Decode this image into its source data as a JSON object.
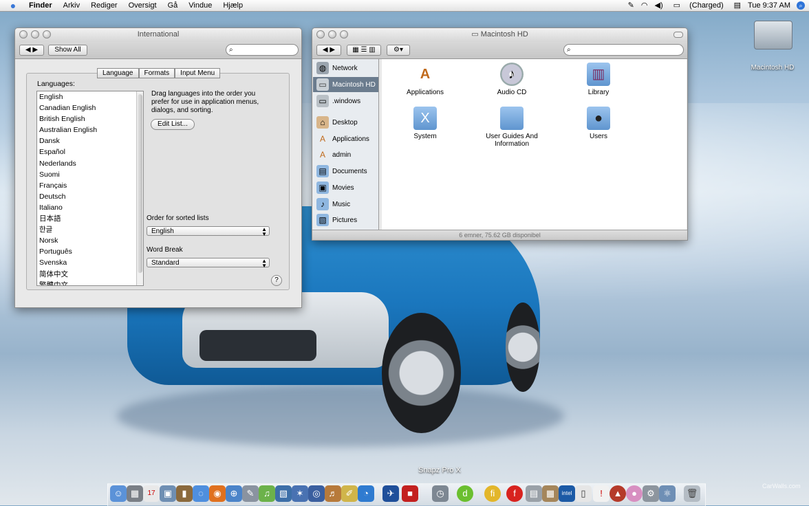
{
  "menubar": {
    "items": [
      "Finder",
      "Arkiv",
      "Rediger",
      "Oversigt",
      "Gå",
      "Vindue",
      "Hjælp"
    ],
    "battery": "(Charged)",
    "clock": "Tue 9:37 AM"
  },
  "international": {
    "title": "International",
    "show_all": "Show All",
    "tabs": [
      "Language",
      "Formats",
      "Input Menu"
    ],
    "languages_label": "Languages:",
    "languages": [
      "English",
      "Canadian English",
      "British English",
      "Australian English",
      "Dansk",
      "Español",
      "Nederlands",
      "Suomi",
      "Français",
      "Deutsch",
      "Italiano",
      "日本語",
      "한글",
      "Norsk",
      "Português",
      "Svenska",
      "简体中文",
      "繁體中文"
    ],
    "drag_text": "Drag languages into the order you prefer for use in application menus, dialogs, and sorting.",
    "edit_list": "Edit List...",
    "sorted_label": "Order for sorted lists",
    "sorted_value": "English",
    "wordbreak_label": "Word Break",
    "wordbreak_value": "Standard",
    "help": "?"
  },
  "finder": {
    "title": "Macintosh HD",
    "sidebar": [
      "Network",
      "Macintosh HD",
      ".windows",
      "Desktop",
      "Applications",
      "admin",
      "Documents",
      "Movies",
      "Music",
      "Pictures"
    ],
    "items": [
      "Applications",
      "Audio CD",
      "Library",
      "System",
      "User Guides And Information",
      "Users"
    ],
    "status": "6 emner, 75.62 GB disponibel"
  },
  "desktop": {
    "hd_label": "Macintosh HD",
    "dock_label": "Snapz Pro X",
    "watermark": "CarWalls.com"
  },
  "colors": {
    "selection": "#6b7c8e",
    "dock_accent": "#3a78d8"
  }
}
